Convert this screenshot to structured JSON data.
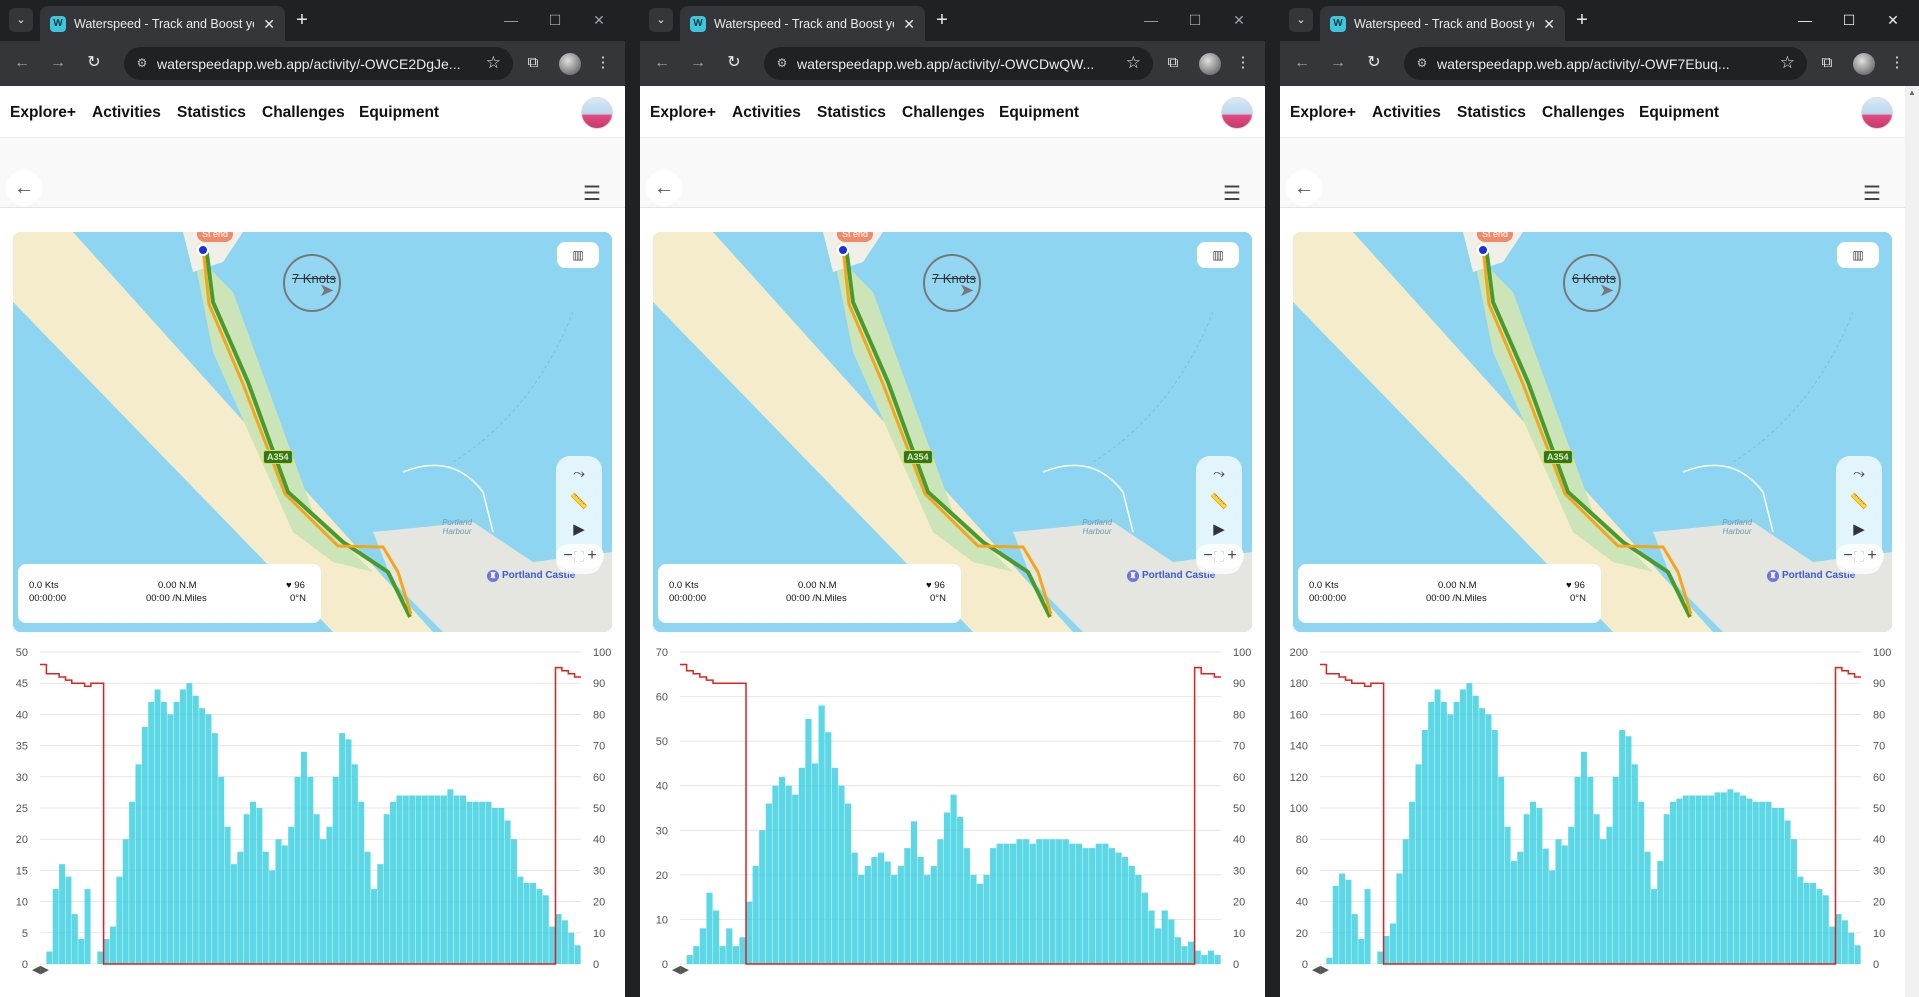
{
  "browser": {
    "tab_title": "Waterspeed - Track and Boost your progress",
    "new_tab_symbol": "+",
    "tab_close_symbol": "✕",
    "window_minimize": "—",
    "window_maximize": "☐",
    "window_close": "✕",
    "icons": [
      "tab-search-icon",
      "back-icon",
      "forward-icon",
      "reload-icon",
      "site-info-icon",
      "bookmark-star-icon",
      "extensions-icon",
      "profile-icon",
      "menu-dots-icon"
    ]
  },
  "app": {
    "nav": [
      "Explore+",
      "Activities",
      "Statistics",
      "Challenges",
      "Equipment"
    ],
    "icons": [
      "back-arrow-icon",
      "hamburger-menu-icon",
      "map-layers-icon",
      "route-icon",
      "ruler-icon",
      "play-icon",
      "fullscreen-icon"
    ]
  },
  "colors": {
    "speed_bars": "#3fd0e0",
    "heart_line": "#e02020",
    "water": "#8ed5f2",
    "track_orange": "#f4a61a",
    "track_green": "#4a9a2e"
  },
  "windows": [
    {
      "url": "waterspeedapp.web.app/activity/-OWCE2DgJe...",
      "map": {
        "wind_label": "7 Knots",
        "start_end_label": "St end",
        "road_label": "A354",
        "place_label": "Portland Harbour",
        "poi_label": "Portland Castle",
        "zoom_out": "−",
        "zoom_in": "+"
      },
      "stats": {
        "speed": "0.0 Kts",
        "time": "00:00:00",
        "distance": "0.00 N.M",
        "pace": "00:00 /N.Miles",
        "heart_rate": "96",
        "heading": "0°N"
      },
      "chart_data": {
        "type": "bar",
        "left_axis": {
          "ticks": [
            0,
            5,
            10,
            15,
            20,
            25,
            30,
            35,
            40,
            45,
            50
          ],
          "range": [
            0,
            50
          ]
        },
        "right_axis": {
          "ticks": [
            0,
            10,
            20,
            30,
            40,
            50,
            60,
            70,
            80,
            90,
            100
          ],
          "range": [
            0,
            100
          ]
        },
        "speed_values": [
          0,
          2,
          12,
          16,
          14,
          8,
          4,
          12,
          0,
          2,
          4,
          6,
          14,
          20,
          26,
          32,
          38,
          42,
          44,
          42,
          40,
          42,
          44,
          45,
          43,
          41,
          40,
          37,
          30,
          22,
          16,
          18,
          24,
          26,
          25,
          18,
          15,
          20,
          19,
          22,
          30,
          34,
          30,
          24,
          20,
          22,
          30,
          37,
          36,
          32,
          26,
          18,
          12,
          16,
          24,
          26,
          27,
          27,
          27,
          27,
          27,
          27,
          27,
          27,
          28,
          27,
          27,
          26,
          26,
          26,
          26,
          25,
          25,
          23,
          20,
          14,
          13,
          13,
          12,
          11,
          6,
          8,
          7,
          5,
          3
        ],
        "heart_values": [
          96,
          93,
          93,
          92,
          91,
          90,
          90,
          89,
          90,
          90,
          0,
          0,
          0,
          0,
          0,
          0,
          0,
          0,
          0,
          0,
          0,
          0,
          0,
          0,
          0,
          0,
          0,
          0,
          0,
          0,
          0,
          0,
          0,
          0,
          0,
          0,
          0,
          0,
          0,
          0,
          0,
          0,
          0,
          0,
          0,
          0,
          0,
          0,
          0,
          0,
          0,
          0,
          0,
          0,
          0,
          0,
          0,
          0,
          0,
          0,
          0,
          0,
          0,
          0,
          0,
          0,
          0,
          0,
          0,
          0,
          0,
          0,
          0,
          0,
          0,
          0,
          0,
          0,
          0,
          0,
          0,
          95,
          94,
          93,
          92
        ],
        "start_marker": "◀▶"
      }
    },
    {
      "url": "waterspeedapp.web.app/activity/-OWCDwQW...",
      "map": {
        "wind_label": "7 Knots",
        "start_end_label": "St end",
        "road_label": "A354",
        "place_label": "Portland Harbour",
        "poi_label": "Portland Castle",
        "zoom_out": "−",
        "zoom_in": "+"
      },
      "stats": {
        "speed": "0.0 Kts",
        "time": "00:00:00",
        "distance": "0.00 N.M",
        "pace": "00:00 /N.Miles",
        "heart_rate": "96",
        "heading": "0°N"
      },
      "chart_data": {
        "type": "bar",
        "left_axis": {
          "ticks": [
            0,
            10,
            20,
            30,
            40,
            50,
            60,
            70
          ],
          "range": [
            0,
            70
          ]
        },
        "right_axis": {
          "ticks": [
            0,
            10,
            20,
            30,
            40,
            50,
            60,
            70,
            80,
            90,
            100
          ],
          "range": [
            0,
            100
          ]
        },
        "speed_values": [
          0,
          2,
          4,
          8,
          16,
          12,
          4,
          8,
          4,
          6,
          14,
          22,
          30,
          36,
          40,
          42,
          40,
          38,
          44,
          55,
          45,
          58,
          52,
          44,
          40,
          36,
          25,
          20,
          22,
          24,
          25,
          23,
          20,
          22,
          26,
          32,
          24,
          20,
          22,
          28,
          34,
          38,
          33,
          26,
          20,
          18,
          20,
          26,
          27,
          27,
          27,
          28,
          28,
          27,
          28,
          28,
          28,
          28,
          28,
          27,
          27,
          26,
          26,
          27,
          27,
          26,
          25,
          24,
          22,
          20,
          16,
          12,
          8,
          12,
          10,
          6,
          4,
          5,
          3,
          2,
          3,
          2
        ],
        "heart_values": [
          96,
          94,
          93,
          92,
          91,
          90,
          90,
          90,
          90,
          90,
          0,
          0,
          0,
          0,
          0,
          0,
          0,
          0,
          0,
          0,
          0,
          0,
          0,
          0,
          0,
          0,
          0,
          0,
          0,
          0,
          0,
          0,
          0,
          0,
          0,
          0,
          0,
          0,
          0,
          0,
          0,
          0,
          0,
          0,
          0,
          0,
          0,
          0,
          0,
          0,
          0,
          0,
          0,
          0,
          0,
          0,
          0,
          0,
          0,
          0,
          0,
          0,
          0,
          0,
          0,
          0,
          0,
          0,
          0,
          0,
          0,
          0,
          0,
          0,
          0,
          0,
          0,
          0,
          95,
          93,
          93,
          92
        ],
        "start_marker": "◀▶"
      }
    },
    {
      "url": "waterspeedapp.web.app/activity/-OWF7Ebuq...",
      "map": {
        "wind_label": "6 Knots",
        "start_end_label": "St end",
        "road_label": "A354",
        "place_label": "Portland Harbour",
        "poi_label": "Portland Castle",
        "zoom_out": "−",
        "zoom_in": "+"
      },
      "stats": {
        "speed": "0.0 Kts",
        "time": "00:00:00",
        "distance": "0.00 N.M",
        "pace": "00:00 /N.Miles",
        "heart_rate": "96",
        "heading": "0°N"
      },
      "chart_data": {
        "type": "bar",
        "left_axis": {
          "ticks": [
            0,
            20,
            40,
            60,
            80,
            100,
            120,
            140,
            160,
            180,
            200
          ],
          "range": [
            0,
            200
          ]
        },
        "right_axis": {
          "ticks": [
            0,
            10,
            20,
            30,
            40,
            50,
            60,
            70,
            80,
            90,
            100
          ],
          "range": [
            0,
            100
          ]
        },
        "speed_values": [
          0,
          4,
          50,
          58,
          54,
          32,
          16,
          48,
          0,
          8,
          18,
          26,
          58,
          80,
          104,
          128,
          150,
          168,
          176,
          168,
          160,
          168,
          176,
          180,
          172,
          164,
          160,
          150,
          120,
          88,
          66,
          72,
          96,
          104,
          100,
          74,
          60,
          80,
          76,
          88,
          120,
          136,
          120,
          96,
          80,
          88,
          120,
          150,
          146,
          128,
          104,
          72,
          48,
          66,
          96,
          104,
          106,
          108,
          108,
          108,
          108,
          108,
          110,
          110,
          112,
          110,
          108,
          106,
          104,
          104,
          104,
          100,
          100,
          92,
          80,
          56,
          52,
          52,
          48,
          44,
          24,
          32,
          28,
          20,
          12
        ],
        "heart_values": [
          96,
          93,
          93,
          92,
          91,
          90,
          90,
          89,
          90,
          90,
          0,
          0,
          0,
          0,
          0,
          0,
          0,
          0,
          0,
          0,
          0,
          0,
          0,
          0,
          0,
          0,
          0,
          0,
          0,
          0,
          0,
          0,
          0,
          0,
          0,
          0,
          0,
          0,
          0,
          0,
          0,
          0,
          0,
          0,
          0,
          0,
          0,
          0,
          0,
          0,
          0,
          0,
          0,
          0,
          0,
          0,
          0,
          0,
          0,
          0,
          0,
          0,
          0,
          0,
          0,
          0,
          0,
          0,
          0,
          0,
          0,
          0,
          0,
          0,
          0,
          0,
          0,
          0,
          0,
          0,
          0,
          95,
          94,
          93,
          92
        ],
        "start_marker": "◀▶"
      }
    }
  ]
}
